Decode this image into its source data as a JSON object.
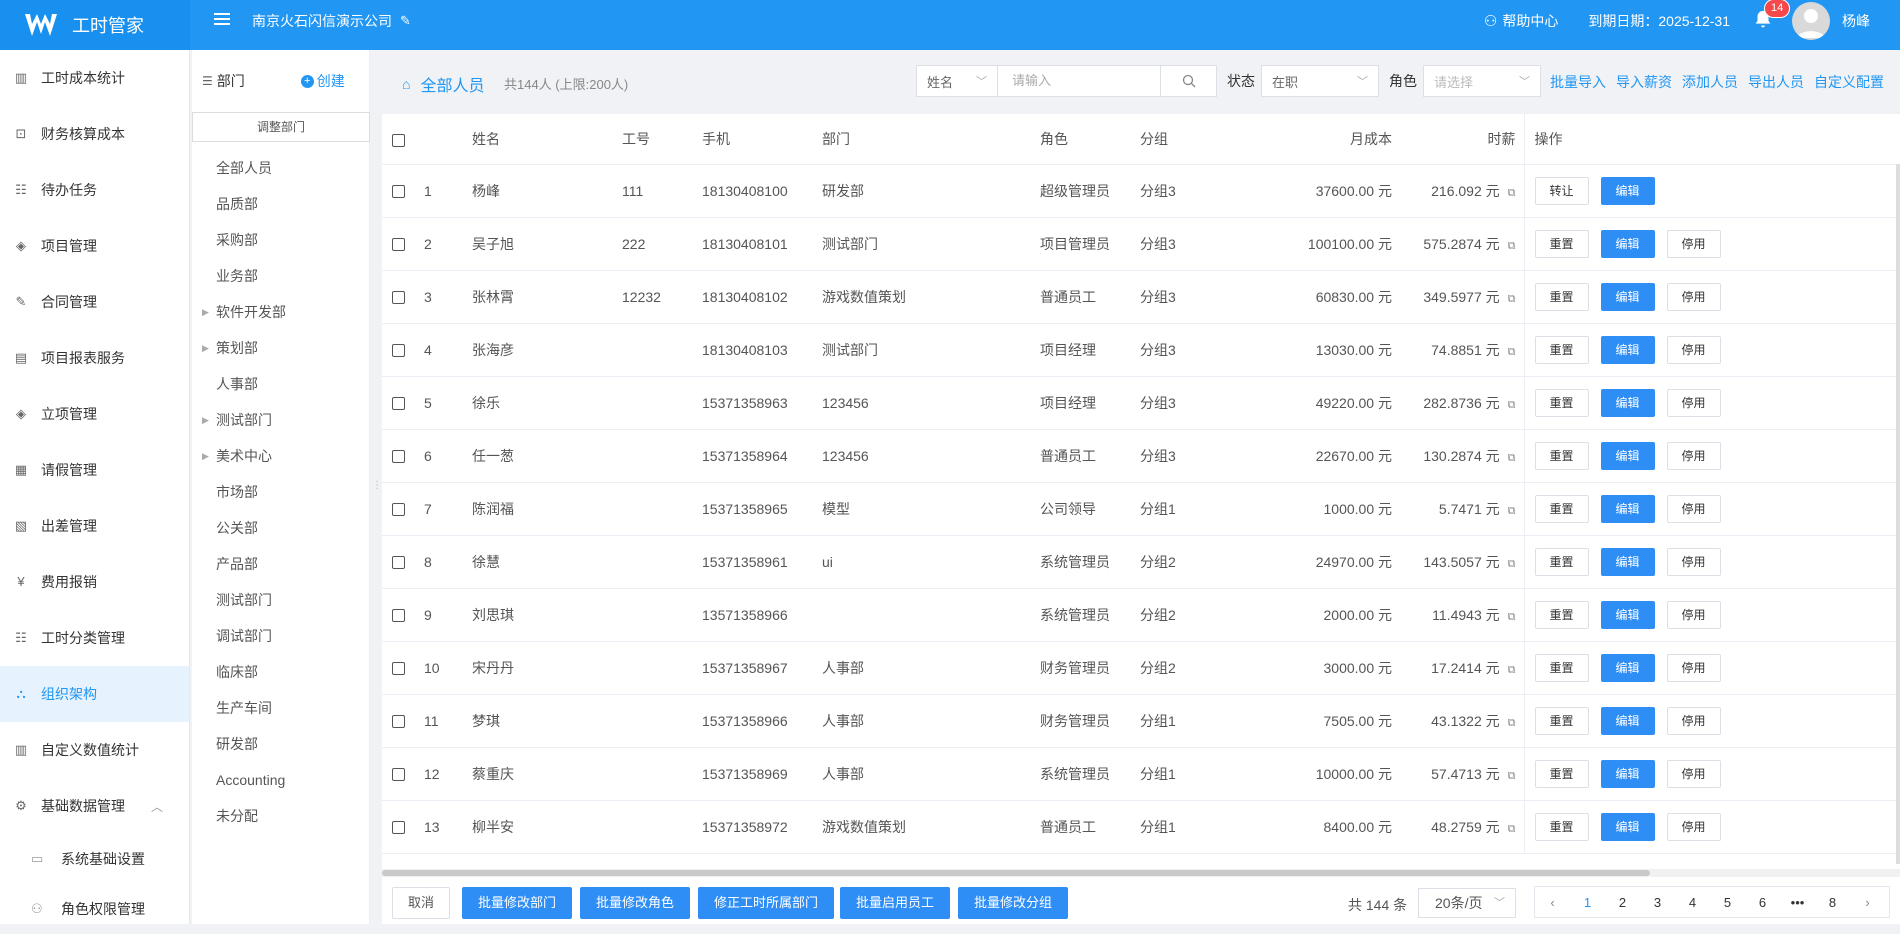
{
  "app": {
    "name": "工时管家"
  },
  "header": {
    "company": "南京火石闪信演示公司",
    "help": "帮助中心",
    "expire": "到期日期：2025-12-31",
    "notification_count": "14",
    "username": "杨峰"
  },
  "sidebar": {
    "items": [
      {
        "label": "工时成本统计",
        "icon": "bar-chart-icon"
      },
      {
        "label": "财务核算成本",
        "icon": "finance-icon"
      },
      {
        "label": "待办任务",
        "icon": "task-list-icon"
      },
      {
        "label": "项目管理",
        "icon": "layers-icon"
      },
      {
        "label": "合同管理",
        "icon": "contract-icon"
      },
      {
        "label": "项目报表服务",
        "icon": "report-icon"
      },
      {
        "label": "立项管理",
        "icon": "layers-icon"
      },
      {
        "label": "请假管理",
        "icon": "leave-icon"
      },
      {
        "label": "出差管理",
        "icon": "trip-icon"
      },
      {
        "label": "费用报销",
        "icon": "expense-icon"
      },
      {
        "label": "工时分类管理",
        "icon": "category-icon"
      },
      {
        "label": "组织架构",
        "icon": "org-icon"
      },
      {
        "label": "自定义数值统计",
        "icon": "bar-chart-icon"
      },
      {
        "label": "基础数据管理",
        "icon": "gear-icon"
      }
    ],
    "sub_items": [
      {
        "label": "系统基础设置",
        "icon": "monitor-icon"
      },
      {
        "label": "角色权限管理",
        "icon": "user-icon"
      }
    ]
  },
  "dept_panel": {
    "title": "部门",
    "create": "创建",
    "adjust": "调整部门",
    "items": [
      {
        "label": "全部人员",
        "expandable": false
      },
      {
        "label": "品质部",
        "expandable": false
      },
      {
        "label": "采购部",
        "expandable": false
      },
      {
        "label": "业务部",
        "expandable": false
      },
      {
        "label": "软件开发部",
        "expandable": true
      },
      {
        "label": "策划部",
        "expandable": true
      },
      {
        "label": "人事部",
        "expandable": false
      },
      {
        "label": "测试部门",
        "expandable": true
      },
      {
        "label": "美术中心",
        "expandable": true
      },
      {
        "label": "市场部",
        "expandable": false
      },
      {
        "label": "公关部",
        "expandable": false
      },
      {
        "label": "产品部",
        "expandable": false
      },
      {
        "label": "测试部门",
        "expandable": false
      },
      {
        "label": "调试部门",
        "expandable": false
      },
      {
        "label": "临床部",
        "expandable": false
      },
      {
        "label": "生产车间",
        "expandable": false
      },
      {
        "label": "研发部",
        "expandable": false
      },
      {
        "label": "Accounting",
        "expandable": false
      },
      {
        "label": "未分配",
        "expandable": false
      }
    ]
  },
  "toolbar": {
    "breadcrumb": "全部人员",
    "count": "共144人 (上限:200人)",
    "search_field": "姓名",
    "search_placeholder": "请输入",
    "status_label": "状态",
    "status_value": "在职",
    "role_label": "角色",
    "role_placeholder": "请选择",
    "links": [
      "批量导入",
      "导入薪资",
      "添加人员",
      "导出人员",
      "自定义配置"
    ]
  },
  "table": {
    "columns": [
      "姓名",
      "工号",
      "手机",
      "部门",
      "角色",
      "分组",
      "月成本",
      "时薪",
      "操作"
    ],
    "rows": [
      {
        "no": "1",
        "name": "杨峰",
        "emp_id": "111",
        "phone": "18130408100",
        "dept": "研发部",
        "role": "超级管理员",
        "group": "分组3",
        "monthly": "37600.00 元",
        "hourly": "216.092 元",
        "ops": [
          "转让",
          "编辑"
        ]
      },
      {
        "no": "2",
        "name": "吴子旭",
        "emp_id": "222",
        "phone": "18130408101",
        "dept": "测试部门",
        "role": "项目管理员",
        "group": "分组3",
        "monthly": "100100.00 元",
        "hourly": "575.2874 元",
        "ops": [
          "重置",
          "编辑",
          "停用"
        ]
      },
      {
        "no": "3",
        "name": "张林霄",
        "emp_id": "12232",
        "phone": "18130408102",
        "dept": "游戏数值策划",
        "role": "普通员工",
        "group": "分组3",
        "monthly": "60830.00 元",
        "hourly": "349.5977 元",
        "ops": [
          "重置",
          "编辑",
          "停用"
        ]
      },
      {
        "no": "4",
        "name": "张海彦",
        "emp_id": "",
        "phone": "18130408103",
        "dept": "测试部门",
        "role": "项目经理",
        "group": "分组3",
        "monthly": "13030.00 元",
        "hourly": "74.8851 元",
        "ops": [
          "重置",
          "编辑",
          "停用"
        ]
      },
      {
        "no": "5",
        "name": "徐乐",
        "emp_id": "",
        "phone": "15371358963",
        "dept": "123456",
        "role": "项目经理",
        "group": "分组3",
        "monthly": "49220.00 元",
        "hourly": "282.8736 元",
        "ops": [
          "重置",
          "编辑",
          "停用"
        ]
      },
      {
        "no": "6",
        "name": "任一葱",
        "emp_id": "",
        "phone": "15371358964",
        "dept": "123456",
        "role": "普通员工",
        "group": "分组3",
        "monthly": "22670.00 元",
        "hourly": "130.2874 元",
        "ops": [
          "重置",
          "编辑",
          "停用"
        ]
      },
      {
        "no": "7",
        "name": "陈润福",
        "emp_id": "",
        "phone": "15371358965",
        "dept": "模型",
        "role": "公司领导",
        "group": "分组1",
        "monthly": "1000.00 元",
        "hourly": "5.7471 元",
        "ops": [
          "重置",
          "编辑",
          "停用"
        ]
      },
      {
        "no": "8",
        "name": "徐慧",
        "emp_id": "",
        "phone": "15371358961",
        "dept": "ui",
        "role": "系统管理员",
        "group": "分组2",
        "monthly": "24970.00 元",
        "hourly": "143.5057 元",
        "ops": [
          "重置",
          "编辑",
          "停用"
        ]
      },
      {
        "no": "9",
        "name": "刘思琪",
        "emp_id": "",
        "phone": "13571358966",
        "dept": "",
        "role": "系统管理员",
        "group": "分组2",
        "monthly": "2000.00 元",
        "hourly": "11.4943 元",
        "ops": [
          "重置",
          "编辑",
          "停用"
        ]
      },
      {
        "no": "10",
        "name": "宋丹丹",
        "emp_id": "",
        "phone": "15371358967",
        "dept": "人事部",
        "role": "财务管理员",
        "group": "分组2",
        "monthly": "3000.00 元",
        "hourly": "17.2414 元",
        "ops": [
          "重置",
          "编辑",
          "停用"
        ]
      },
      {
        "no": "11",
        "name": "梦琪",
        "emp_id": "",
        "phone": "15371358966",
        "dept": "人事部",
        "role": "财务管理员",
        "group": "分组1",
        "monthly": "7505.00 元",
        "hourly": "43.1322 元",
        "ops": [
          "重置",
          "编辑",
          "停用"
        ]
      },
      {
        "no": "12",
        "name": "蔡重庆",
        "emp_id": "",
        "phone": "15371358969",
        "dept": "人事部",
        "role": "系统管理员",
        "group": "分组1",
        "monthly": "10000.00 元",
        "hourly": "57.4713 元",
        "ops": [
          "重置",
          "编辑",
          "停用"
        ]
      },
      {
        "no": "13",
        "name": "柳半安",
        "emp_id": "",
        "phone": "15371358972",
        "dept": "游戏数值策划",
        "role": "普通员工",
        "group": "分组1",
        "monthly": "8400.00 元",
        "hourly": "48.2759 元",
        "ops": [
          "重置",
          "编辑",
          "停用"
        ]
      }
    ]
  },
  "footer": {
    "buttons": [
      "取消",
      "批量修改部门",
      "批量修改角色",
      "修正工时所属部门",
      "批量启用员工",
      "批量修改分组"
    ],
    "total": "共 144 条",
    "page_size": "20条/页",
    "pages": [
      "1",
      "2",
      "3",
      "4",
      "5",
      "6",
      "•••",
      "8"
    ],
    "current_page": "1"
  },
  "colors": {
    "primary": "#2196f3",
    "active_bg": "#e6f2fd"
  }
}
